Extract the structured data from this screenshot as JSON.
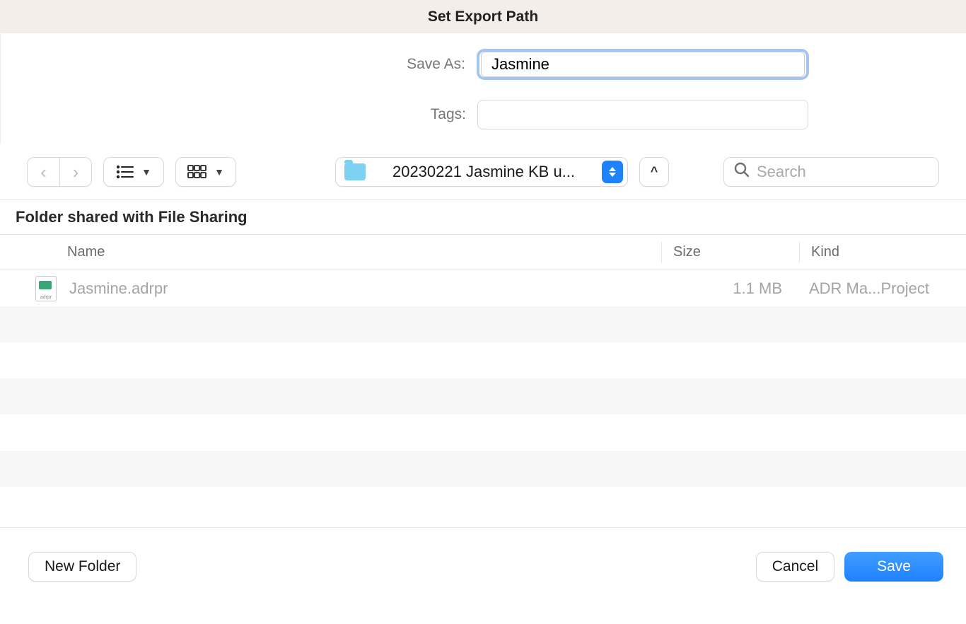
{
  "window": {
    "title": "Set Export Path"
  },
  "form": {
    "save_as_label": "Save As:",
    "save_as_value": "Jasmine",
    "tags_label": "Tags:",
    "tags_value": ""
  },
  "toolbar": {
    "current_folder": "20230221 Jasmine KB u...",
    "search_placeholder": "Search"
  },
  "info_bar": "Folder shared with File Sharing",
  "columns": {
    "name": "Name",
    "size": "Size",
    "kind": "Kind"
  },
  "files": [
    {
      "name": "Jasmine.adrpr",
      "size": "1.1 MB",
      "kind": "ADR Ma...Project",
      "icon_ext": "adrpr"
    }
  ],
  "footer": {
    "new_folder": "New Folder",
    "cancel": "Cancel",
    "save": "Save"
  }
}
